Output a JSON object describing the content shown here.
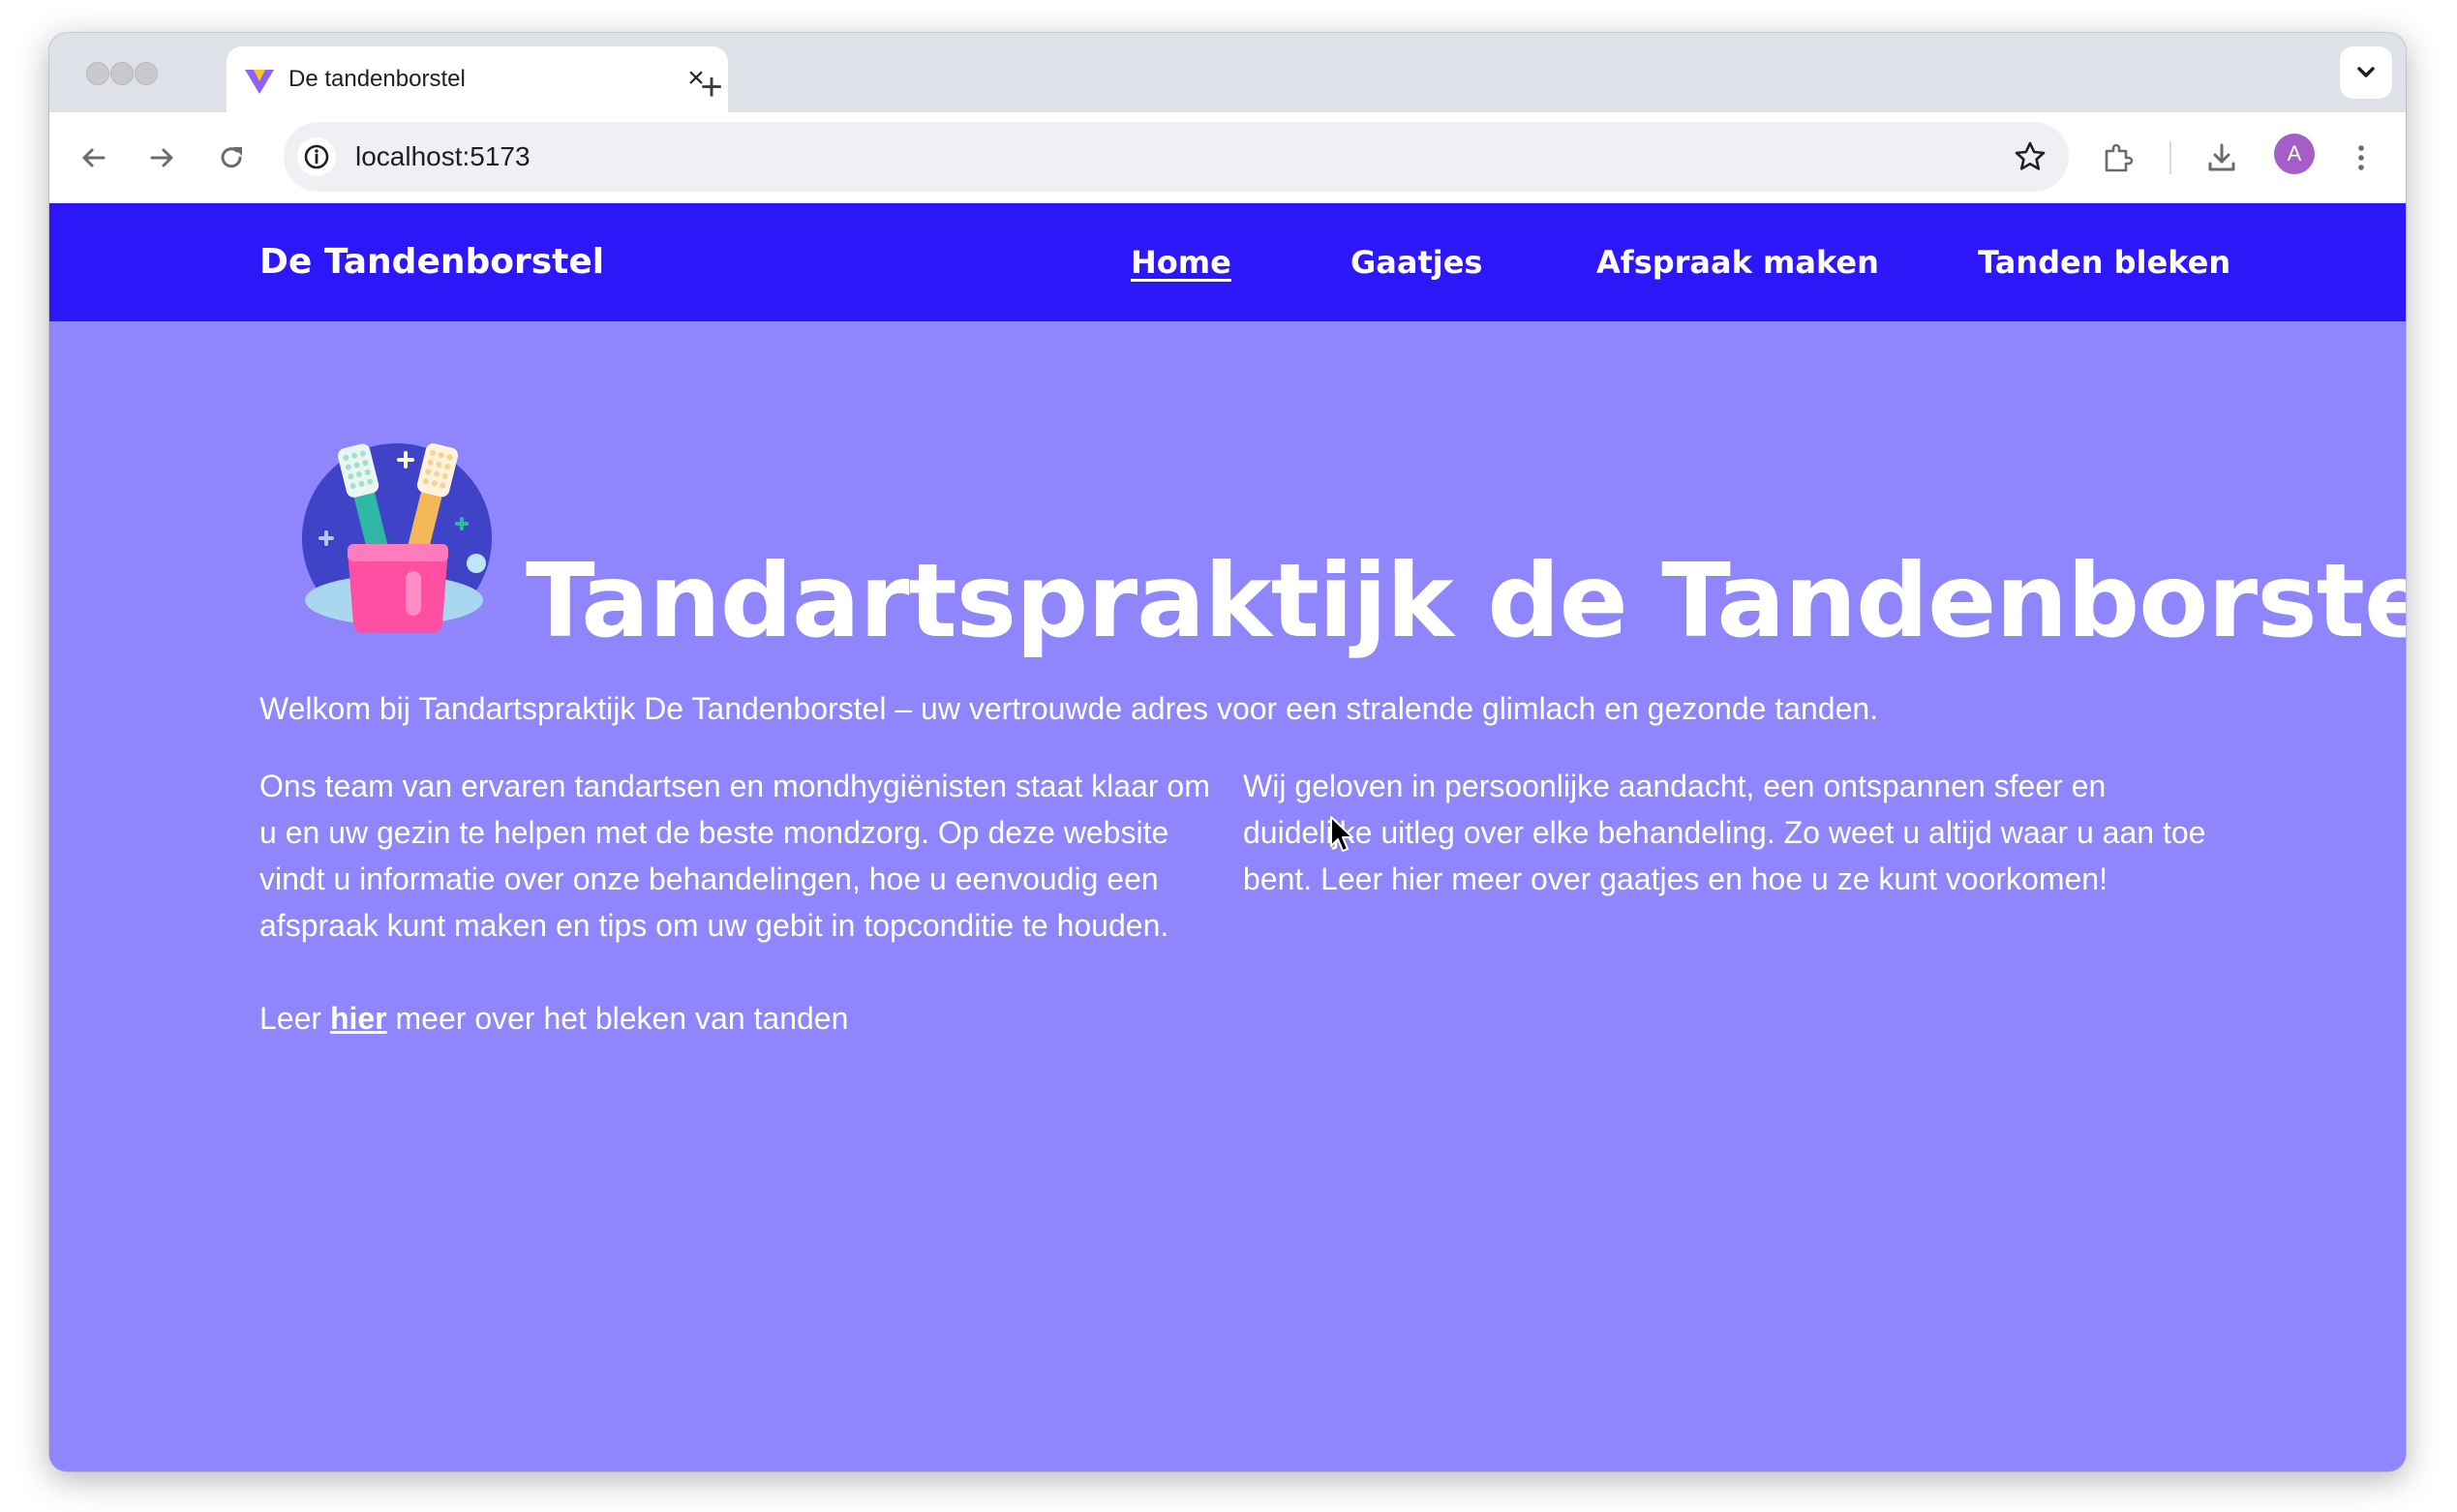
{
  "browser": {
    "tab_title": "De tandenborstel",
    "new_tab_symbol": "+",
    "close_symbol": "×",
    "url": "localhost:5173",
    "profile_initial": "A",
    "icons": [
      "back-arrow-icon",
      "forward-arrow-icon",
      "reload-icon",
      "site-info-icon",
      "bookmark-star-icon",
      "extensions-icon",
      "download-icon",
      "more-vert-icon",
      "tab-search-chevron-icon"
    ]
  },
  "nav": {
    "brand": "De Tandenborstel",
    "links": [
      {
        "label": "Home",
        "active": true
      },
      {
        "label": "Gaatjes",
        "active": false
      },
      {
        "label": "Afspraak maken",
        "active": false
      },
      {
        "label": "Tanden bleken",
        "active": false
      }
    ]
  },
  "hero": {
    "title": "Tandartspraktijk de Tandenborstel",
    "logo_icon": "toothbrush-cup-icon"
  },
  "content": {
    "intro": "Welkom bij Tandartspraktijk De Tandenborstel – uw vertrouwde adres voor een stralende glimlach en gezonde tanden.",
    "col1": "Ons team van ervaren tandartsen en mondhygiënisten staat klaar om u en uw gezin te helpen met de beste mondzorg. Op deze website vindt u informatie over onze behandelingen, hoe u eenvoudig een afspraak kunt maken en tips om uw gebit in topconditie te houden.",
    "col2": "Wij geloven in persoonlijke aandacht, een ontspannen sfeer en duidelijke uitleg over elke behandeling. Zo weet u altijd waar u aan toe bent. Leer hier meer over gaatjes en hoe u ze kunt voorkomen!",
    "leer_prefix": "Leer ",
    "leer_link": "hier",
    "leer_suffix": " meer over het bleken van tanden"
  },
  "colors": {
    "nav_bg": "#2b17f7",
    "page_bg": "#8f85fd",
    "text": "#ffffff"
  }
}
